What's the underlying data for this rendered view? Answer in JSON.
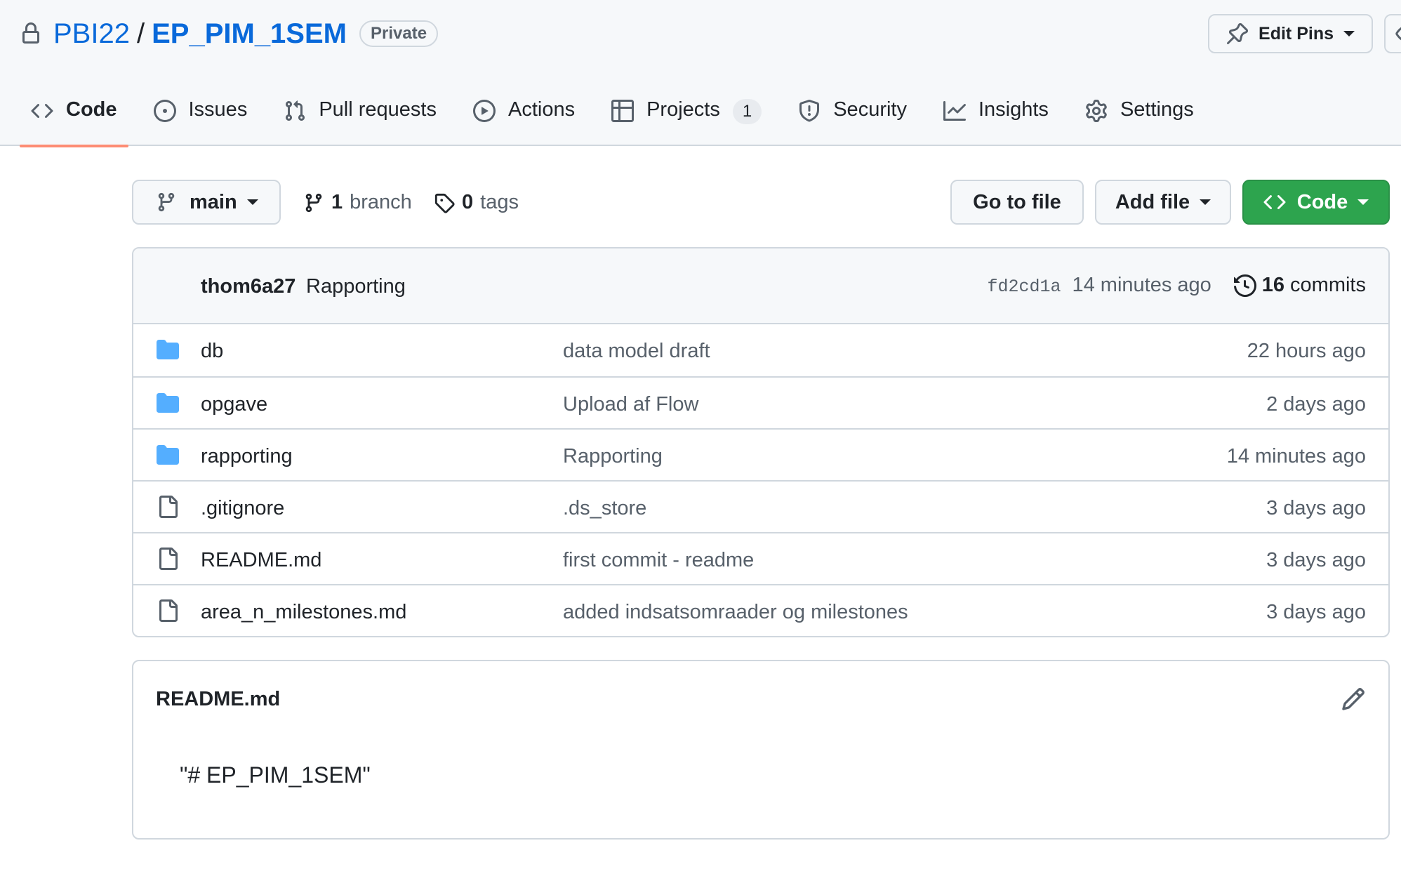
{
  "repo": {
    "owner": "PBI22",
    "separator": "/",
    "name": "EP_PIM_1SEM",
    "visibility": "Private"
  },
  "header_actions": {
    "edit_pins_label": "Edit Pins"
  },
  "tabs": [
    {
      "label": "Code",
      "icon": "code-icon",
      "selected": true
    },
    {
      "label": "Issues",
      "icon": "issue-opened-icon"
    },
    {
      "label": "Pull requests",
      "icon": "git-pull-request-icon"
    },
    {
      "label": "Actions",
      "icon": "play-icon"
    },
    {
      "label": "Projects",
      "icon": "table-icon",
      "counter": "1"
    },
    {
      "label": "Security",
      "icon": "shield-icon"
    },
    {
      "label": "Insights",
      "icon": "graph-icon"
    },
    {
      "label": "Settings",
      "icon": "gear-icon"
    }
  ],
  "file_nav": {
    "branch": "main",
    "branch_count": "1",
    "branch_label": "branch",
    "tag_count": "0",
    "tag_label": "tags",
    "go_to_file": "Go to file",
    "add_file": "Add file",
    "code": "Code"
  },
  "latest_commit": {
    "author": "thom6a27",
    "message": "Rapporting",
    "sha": "fd2cd1a",
    "time": "14 minutes ago",
    "commit_count": "16",
    "commit_label": "commits"
  },
  "files": [
    {
      "type": "folder",
      "name": "db",
      "message": "data model draft",
      "age": "22 hours ago"
    },
    {
      "type": "folder",
      "name": "opgave",
      "message": "Upload af Flow",
      "age": "2 days ago"
    },
    {
      "type": "folder",
      "name": "rapporting",
      "message": "Rapporting",
      "age": "14 minutes ago"
    },
    {
      "type": "file",
      "name": ".gitignore",
      "message": ".ds_store",
      "age": "3 days ago"
    },
    {
      "type": "file",
      "name": "README.md",
      "message": "first commit - readme",
      "age": "3 days ago"
    },
    {
      "type": "file",
      "name": "area_n_milestones.md",
      "message": "added indsatsomraader og milestones",
      "age": "3 days ago"
    }
  ],
  "readme": {
    "title": "README.md",
    "content": "\"# EP_PIM_1SEM\""
  },
  "colors": {
    "link": "#0969da",
    "folder": "#54aeff",
    "tab_underline": "#fd8c73",
    "code_button": "#2da44e"
  }
}
